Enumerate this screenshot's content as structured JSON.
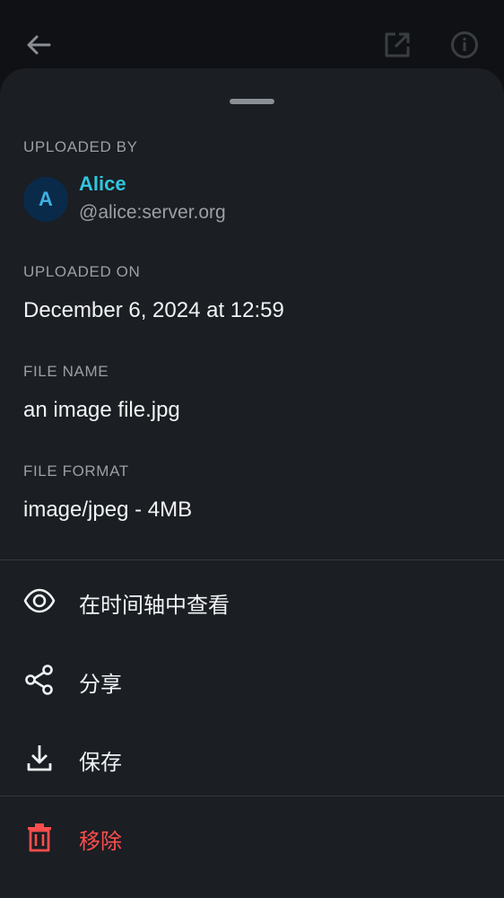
{
  "topbar": {
    "back_icon": "arrow-left-icon",
    "open_external_icon": "open-external-icon",
    "info_icon": "info-icon"
  },
  "details": {
    "uploaded_by_label": "UPLOADED BY",
    "user": {
      "avatar_letter": "A",
      "display_name": "Alice",
      "user_id": "@alice:server.org"
    },
    "uploaded_on_label": "UPLOADED ON",
    "uploaded_on_value": "December 6, 2024 at 12:59",
    "file_name_label": "FILE NAME",
    "file_name_value": "an image file.jpg",
    "file_format_label": "FILE FORMAT",
    "file_format_value": "image/jpeg - 4MB"
  },
  "actions": {
    "view_in_timeline": "在时间轴中查看",
    "share": "分享",
    "save": "保存",
    "remove": "移除"
  },
  "colors": {
    "accent": "#31c6e0",
    "danger": "#ff4d4d",
    "sheet_background": "#1b1e22",
    "screen_background": "#0f1114"
  }
}
